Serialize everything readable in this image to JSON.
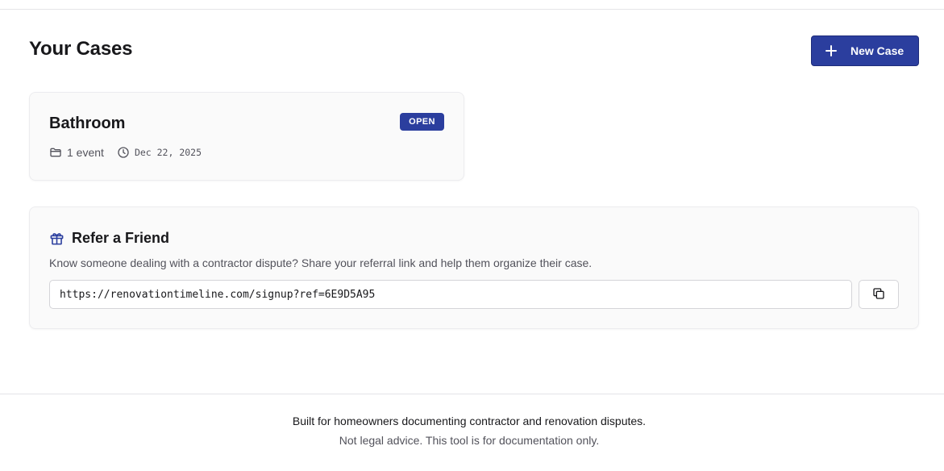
{
  "page": {
    "title": "Your Cases",
    "new_case_label": "New Case"
  },
  "cases": [
    {
      "title": "Bathroom",
      "status": "OPEN",
      "events": "1 event",
      "date": "Dec 22, 2025"
    }
  ],
  "referral": {
    "title": "Refer a Friend",
    "description": "Know someone dealing with a contractor dispute? Share your referral link and help them organize their case.",
    "link": "https://renovationtimeline.com/signup?ref=6E9D5A95"
  },
  "footer": {
    "main": "Built for homeowners documenting contractor and renovation disputes.",
    "sub": "Not legal advice. This tool is for documentation only."
  },
  "colors": {
    "accent": "#2b3e9e",
    "text": "#18181b",
    "muted": "#52525b",
    "card_bg": "#fafafa"
  },
  "icons": [
    "plus-icon",
    "folder-icon",
    "clock-icon",
    "gift-icon",
    "copy-icon"
  ]
}
